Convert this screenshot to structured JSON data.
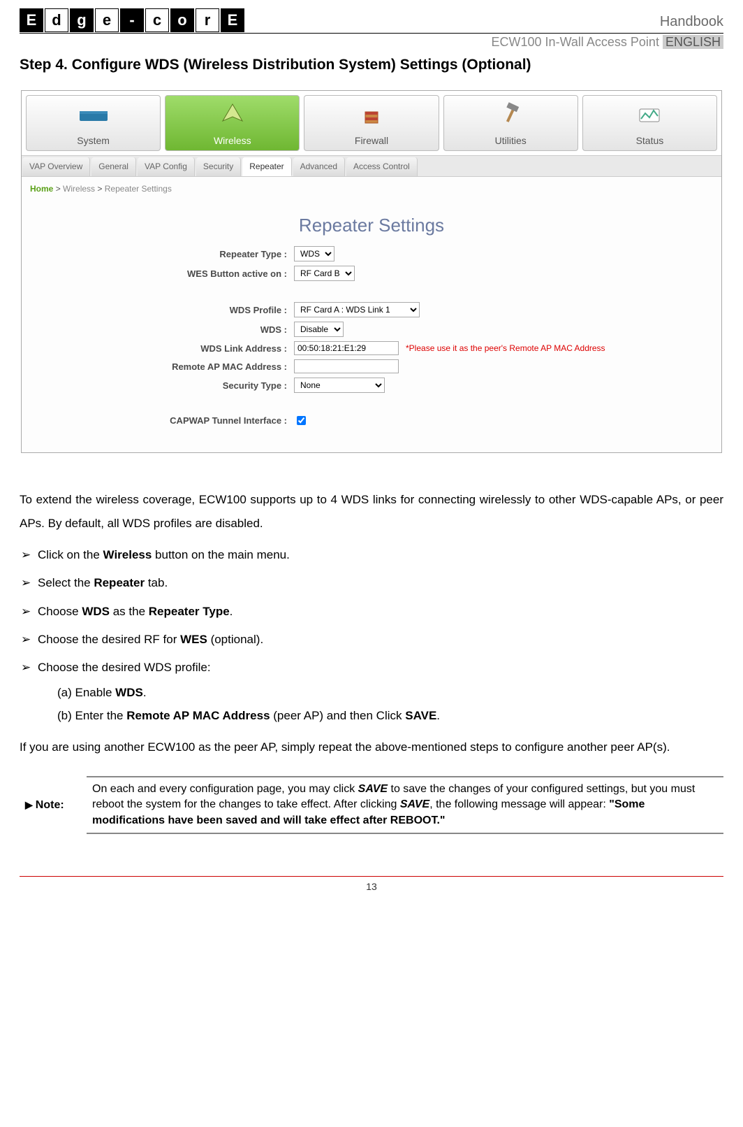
{
  "header": {
    "logo_letters": [
      "E",
      "d",
      "g",
      "e",
      "-",
      "c",
      "o",
      "r",
      "E"
    ],
    "handbook": "Handbook",
    "product": "ECW100 In-Wall Access Point",
    "lang_badge": "ENGLISH"
  },
  "step_title": "Step 4. Configure WDS (Wireless Distribution System) Settings (Optional)",
  "screenshot": {
    "mainnav": [
      {
        "label": "System",
        "selected": false,
        "icon": "router-icon"
      },
      {
        "label": "Wireless",
        "selected": true,
        "icon": "wireless-icon"
      },
      {
        "label": "Firewall",
        "selected": false,
        "icon": "firewall-icon"
      },
      {
        "label": "Utilities",
        "selected": false,
        "icon": "hammer-icon"
      },
      {
        "label": "Status",
        "selected": false,
        "icon": "status-icon"
      }
    ],
    "subnav": [
      {
        "label": "VAP Overview",
        "active": false
      },
      {
        "label": "General",
        "active": false
      },
      {
        "label": "VAP Config",
        "active": false
      },
      {
        "label": "Security",
        "active": false
      },
      {
        "label": "Repeater",
        "active": true
      },
      {
        "label": "Advanced",
        "active": false
      },
      {
        "label": "Access Control",
        "active": false
      }
    ],
    "breadcrumb": {
      "home": "Home",
      "sep": ">",
      "section": "Wireless",
      "page": "Repeater Settings"
    },
    "panel_title": "Repeater Settings",
    "fields": {
      "repeater_type_label": "Repeater Type :",
      "repeater_type_value": "WDS",
      "wes_label": "WES Button active on :",
      "wes_value": "RF Card B",
      "wds_profile_label": "WDS Profile :",
      "wds_profile_value": "RF Card A : WDS Link 1",
      "wds_label": "WDS :",
      "wds_value": "Disable",
      "wds_link_addr_label": "WDS Link Address :",
      "wds_link_addr_value": "00:50:18:21:E1:29",
      "wds_link_hint": "*Please use it as the peer's Remote AP MAC Address",
      "remote_mac_label": "Remote AP MAC Address :",
      "remote_mac_value": "",
      "security_label": "Security Type :",
      "security_value": "None",
      "capwap_label": "CAPWAP Tunnel Interface :",
      "capwap_checked": true
    }
  },
  "body": {
    "intro": "To extend the wireless coverage, ECW100 supports up to 4 WDS links for connecting wirelessly to other WDS-capable APs, or peer APs. By default, all WDS profiles are disabled.",
    "bullets": {
      "b1_pre": "Click on the ",
      "b1_bold": "Wireless",
      "b1_post": " button on the main menu.",
      "b2_pre": "Select the ",
      "b2_bold": "Repeater",
      "b2_post": " tab.",
      "b3_pre": "Choose ",
      "b3_bold1": "WDS",
      "b3_mid": " as the ",
      "b3_bold2": "Repeater Type",
      "b3_post": ".",
      "b4_pre": "Choose the desired RF for ",
      "b4_bold": "WES",
      "b4_post": " (optional).",
      "b5": "Choose the desired WDS profile:",
      "a_label": "(a)",
      "a_pre": " Enable ",
      "a_bold": "WDS",
      "a_post": ".",
      "b_label": "(b)",
      "b_pre": " Enter the ",
      "b_bold": "Remote AP MAC Address",
      "b_mid": " (peer AP) and then Click ",
      "b_bold2": "SAVE",
      "b_post": "."
    },
    "outro": "If you are using another ECW100 as the peer AP, simply repeat the above-mentioned steps to configure another peer AP(s)."
  },
  "note": {
    "label": "Note:",
    "text_pre": "On each and every configuration page, you may click ",
    "save1": "SAVE",
    "text_mid1": " to save the changes of your configured settings, but you must reboot the system for the changes to take effect. After clicking ",
    "save2": "SAVE",
    "text_mid2": ", the following message will appear: ",
    "quote": "\"Some modifications have been saved and will take effect after REBOOT.\""
  },
  "footer": {
    "page_number": "13"
  }
}
